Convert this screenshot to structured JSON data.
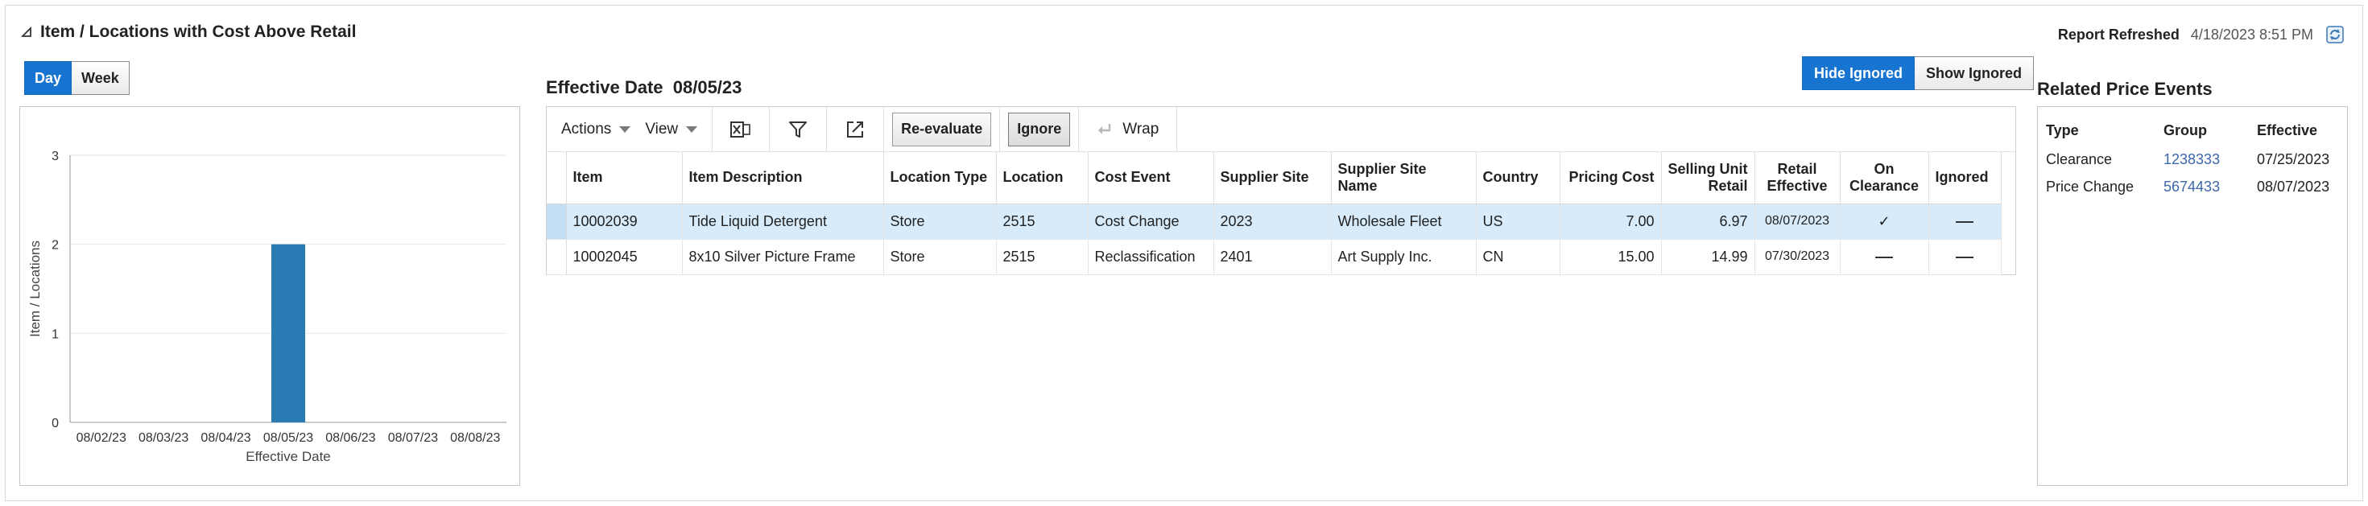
{
  "header": {
    "title": "Item / Locations with Cost Above Retail",
    "refreshed_label": "Report Refreshed",
    "refreshed_value": "4/18/2023 8:51 PM"
  },
  "period_toggle": {
    "day": "Day",
    "week": "Week",
    "selected": "Day"
  },
  "chart_data": {
    "type": "bar",
    "categories": [
      "08/02/23",
      "08/03/23",
      "08/04/23",
      "08/05/23",
      "08/06/23",
      "08/07/23",
      "08/08/23"
    ],
    "values": [
      0,
      0,
      0,
      2,
      0,
      0,
      0
    ],
    "xlabel": "Effective Date",
    "ylabel": "Item / Locations",
    "ylim": [
      0,
      3
    ],
    "yticks": [
      "0",
      "1",
      "2",
      "3"
    ],
    "grid": true,
    "bar_color": "#2a7ab4"
  },
  "effective": {
    "label": "Effective Date",
    "value": "08/05/23"
  },
  "ignore_toggle": {
    "hide": "Hide Ignored",
    "show": "Show Ignored",
    "selected": "Hide Ignored"
  },
  "toolbar": {
    "actions": "Actions",
    "view": "View",
    "reevaluate": "Re-evaluate",
    "ignore": "Ignore",
    "wrap": "Wrap"
  },
  "grid": {
    "columns": [
      "Item",
      "Item Description",
      "Location Type",
      "Location",
      "Cost Event",
      "Supplier Site",
      "Supplier Site Name",
      "Country",
      "Pricing Cost",
      "Selling Unit Retail",
      "Retail Effective",
      "On Clearance",
      "Ignored"
    ],
    "rows": [
      {
        "item": "10002039",
        "description": "Tide Liquid Detergent",
        "location_type": "Store",
        "location": "2515",
        "cost_event": "Cost Change",
        "supplier_site": "2023",
        "supplier_site_name": "Wholesale Fleet",
        "country": "US",
        "pricing_cost": "7.00",
        "selling_unit_retail": "6.97",
        "retail_effective": "08/07/2023",
        "on_clearance": "✓",
        "ignored": "",
        "selected": true
      },
      {
        "item": "10002045",
        "description": "8x10 Silver Picture Frame",
        "location_type": "Store",
        "location": "2515",
        "cost_event": "Reclassification",
        "supplier_site": "2401",
        "supplier_site_name": "Art Supply Inc.",
        "country": "CN",
        "pricing_cost": "15.00",
        "selling_unit_retail": "14.99",
        "retail_effective": "07/30/2023",
        "on_clearance": "",
        "ignored": "",
        "selected": false
      }
    ]
  },
  "related": {
    "title": "Related Price Events",
    "columns": [
      "Type",
      "Group",
      "Effective"
    ],
    "rows": [
      {
        "type": "Clearance",
        "group": "1238333",
        "effective": "07/25/2023"
      },
      {
        "type": "Price Change",
        "group": "5674433",
        "effective": "08/07/2023"
      }
    ]
  },
  "colors": {
    "accent": "#1774d1",
    "selected_row": "#d7ebfa",
    "link": "#3c67a8"
  }
}
